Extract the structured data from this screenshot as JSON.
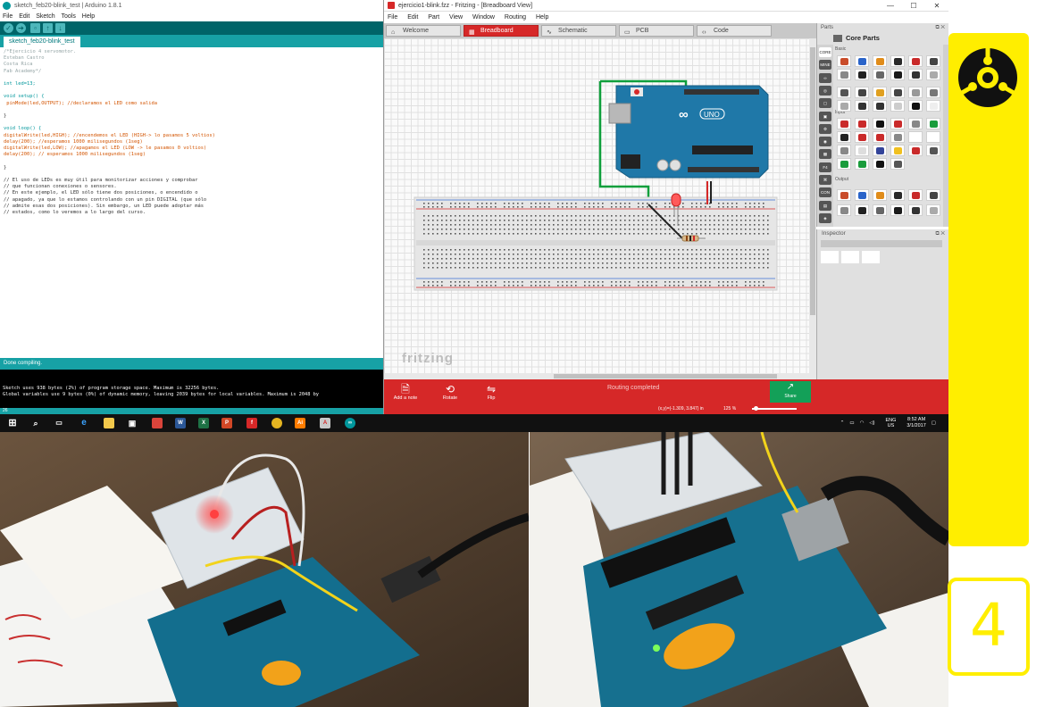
{
  "arduino": {
    "title": "sketch_feb20-blink_test | Arduino 1.8.1",
    "menu": [
      "File",
      "Edit",
      "Sketch",
      "Tools",
      "Help"
    ],
    "tab": "sketch_feb20-blink_test",
    "code": [
      {
        "t": "/*Ejercicio 4 servomotor.",
        "c": "com"
      },
      {
        "t": "Esteban Castro",
        "c": "com"
      },
      {
        "t": "Costa Rica",
        "c": "com"
      },
      {
        "t": "Fab Academy*/",
        "c": "com"
      },
      {
        "t": "",
        "c": ""
      },
      {
        "t": "int led=13;",
        "c": "kw"
      },
      {
        "t": "",
        "c": ""
      },
      {
        "t": "void setup() {",
        "c": "kw"
      },
      {
        "t": " pinMode(led,OUTPUT); //declaramos el LED como salida",
        "c": "fn"
      },
      {
        "t": "",
        "c": ""
      },
      {
        "t": "}",
        "c": ""
      },
      {
        "t": "",
        "c": ""
      },
      {
        "t": "void loop() {",
        "c": "kw"
      },
      {
        "t": "digitalWrite(led,HIGH); //encendemos el LED (HIGH-> lo pasamos 5 voltios)",
        "c": "fn"
      },
      {
        "t": "delay(200); //esperamos 1000 milisegundos (1seg)",
        "c": "fn"
      },
      {
        "t": "digitalWrite(led,LOW); //apagamos el LED (LOW -> le pasamos 0 voltios)",
        "c": "fn"
      },
      {
        "t": "delay(200); // esperamos 1000 milisegundos (1seg)",
        "c": "fn"
      },
      {
        "t": "",
        "c": ""
      },
      {
        "t": "}",
        "c": ""
      },
      {
        "t": "",
        "c": ""
      },
      {
        "t": "// El uso de LEDs es muy útil para monitorizar acciones y comprobar",
        "c": ""
      },
      {
        "t": "// que funcionan conexiones o sensores.",
        "c": ""
      },
      {
        "t": "// En este ejemplo, el LED sólo tiene dos posiciones, o encendido o",
        "c": ""
      },
      {
        "t": "// apagado, ya que lo estamos controlando con un pin DIGITAL (que sólo",
        "c": ""
      },
      {
        "t": "// admite esas dos posiciones). Sin embargo, un LED puede adoptar más",
        "c": ""
      },
      {
        "t": "// estados, como lo veremos a lo largo del curso.",
        "c": ""
      }
    ],
    "status": "Done compiling.",
    "console": [
      "Sketch uses 938 bytes (2%) of program storage space. Maximum is 32256 bytes.",
      "Global variables use 9 bytes (0%) of dynamic memory, leaving 2039 bytes for local variables. Maximum is 2048 by"
    ],
    "footer": "26"
  },
  "fritzing": {
    "title": "ejercicio1-blink.fzz - Fritzing - [Breadboard View]",
    "menu": [
      "File",
      "Edit",
      "Part",
      "View",
      "Window",
      "Routing",
      "Help"
    ],
    "tabs": [
      {
        "label": "Welcome",
        "icon": "⌂"
      },
      {
        "label": "Breadboard",
        "icon": "▦"
      },
      {
        "label": "Schematic",
        "icon": "∿"
      },
      {
        "label": "PCB",
        "icon": "▭"
      },
      {
        "label": "Code",
        "icon": "‹›"
      }
    ],
    "active_tab": "Breadboard",
    "watermark": "fritzing",
    "board_label": "UNO",
    "tools": [
      "Add a note",
      "Rotate",
      "Flip"
    ],
    "routing_status": "Routing completed",
    "share_label": "Share",
    "coords": "(x,y)=(-1.309, 3.847) in",
    "zoom": "125 %",
    "parts_title": "Parts",
    "parts_bin": "Core Parts",
    "parts_sections": [
      "Basic",
      "Input",
      "Output"
    ],
    "sidebar_labels": [
      "CORE",
      "MINE",
      "∞",
      "◎",
      "▢",
      "▣",
      "⚙",
      "◉",
      "▩",
      "F4",
      "⌘",
      "CON TRIB",
      "▤",
      "◈"
    ],
    "inspector_title": "Inspector"
  },
  "taskbar": {
    "lang": "ENG",
    "region": "US",
    "time": "8:52 AM",
    "date": "3/1/2017"
  },
  "sidebar": {
    "number": "4"
  },
  "colors": {
    "arduino_teal": "#00979c",
    "fritzing_red": "#d62828",
    "accent_yellow": "#ffee00",
    "board_blue": "#1f78a8"
  }
}
